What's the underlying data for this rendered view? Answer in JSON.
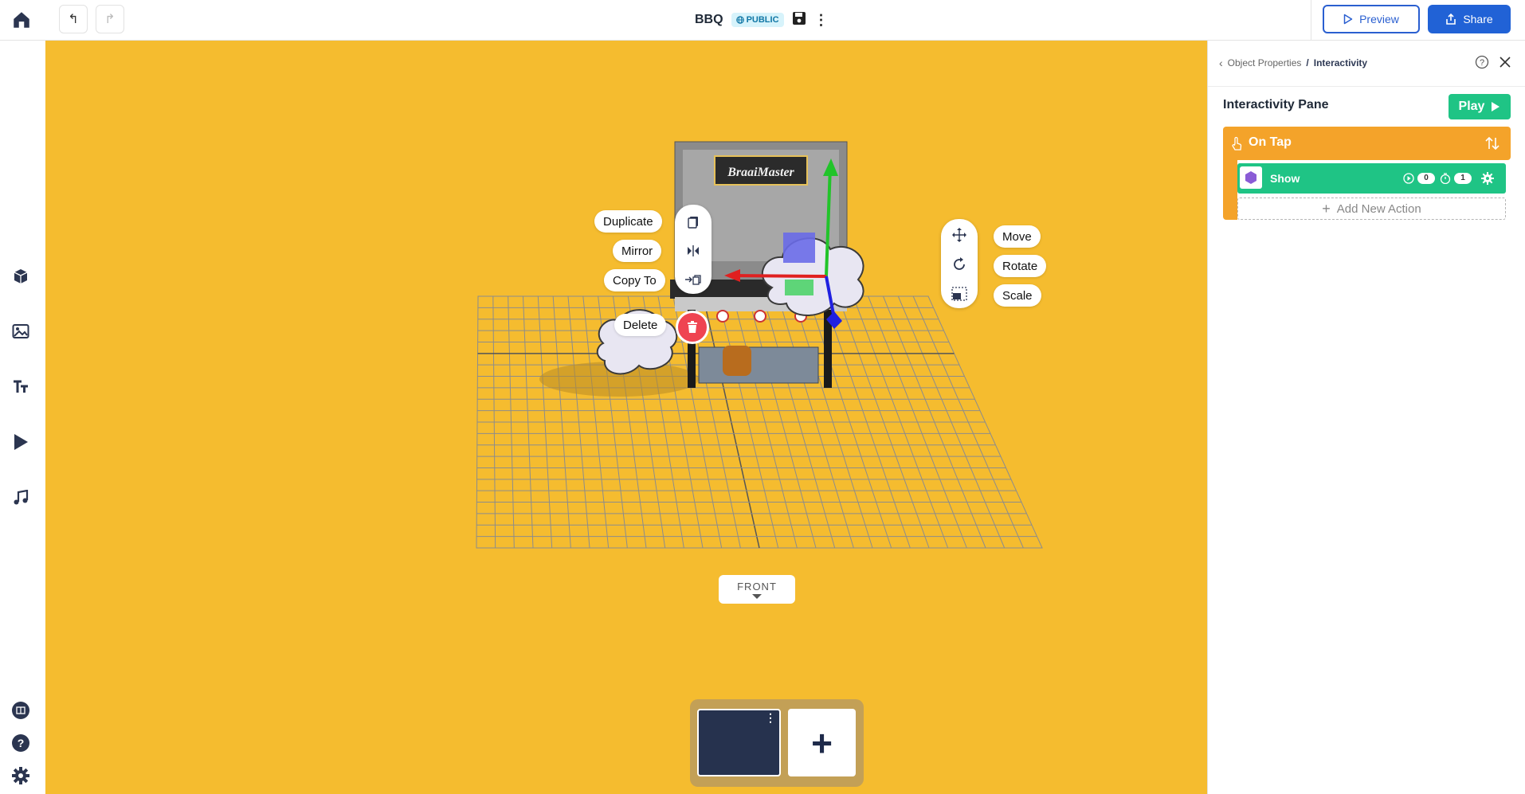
{
  "topbar": {
    "title": "BBQ",
    "visibility_badge": "PUBLIC",
    "undo_icon": "undo-icon",
    "redo_icon": "redo-icon",
    "preview_label": "Preview",
    "share_label": "Share"
  },
  "sidebar": {
    "items": [
      {
        "icon": "cube-icon"
      },
      {
        "icon": "image-icon"
      },
      {
        "icon": "text-icon"
      },
      {
        "icon": "play-icon"
      },
      {
        "icon": "music-icon"
      }
    ],
    "bottom": [
      {
        "icon": "book-icon"
      },
      {
        "icon": "help-icon"
      },
      {
        "icon": "gear-icon"
      }
    ]
  },
  "canvas": {
    "background": "#f5bc2f",
    "context_menu": {
      "duplicate": "Duplicate",
      "mirror": "Mirror",
      "copy_to": "Copy To",
      "delete": "Delete"
    },
    "transform_menu": {
      "move": "Move",
      "rotate": "Rotate",
      "scale": "Scale"
    },
    "model_sign": "BraaiMaster",
    "view_label": "FRONT"
  },
  "scenes": {
    "add_label": "+"
  },
  "panel": {
    "breadcrumb_parent": "Object Properties",
    "breadcrumb_separator": "/",
    "breadcrumb_current": "Interactivity",
    "pane_title": "Interactivity Pane",
    "play_label": "Play",
    "event": {
      "label": "On Tap",
      "color": "#f4a32a",
      "action": {
        "label": "Show",
        "delay": "0",
        "duration": "1",
        "color": "#1fc485"
      },
      "add_action_label": "Add New Action"
    }
  }
}
